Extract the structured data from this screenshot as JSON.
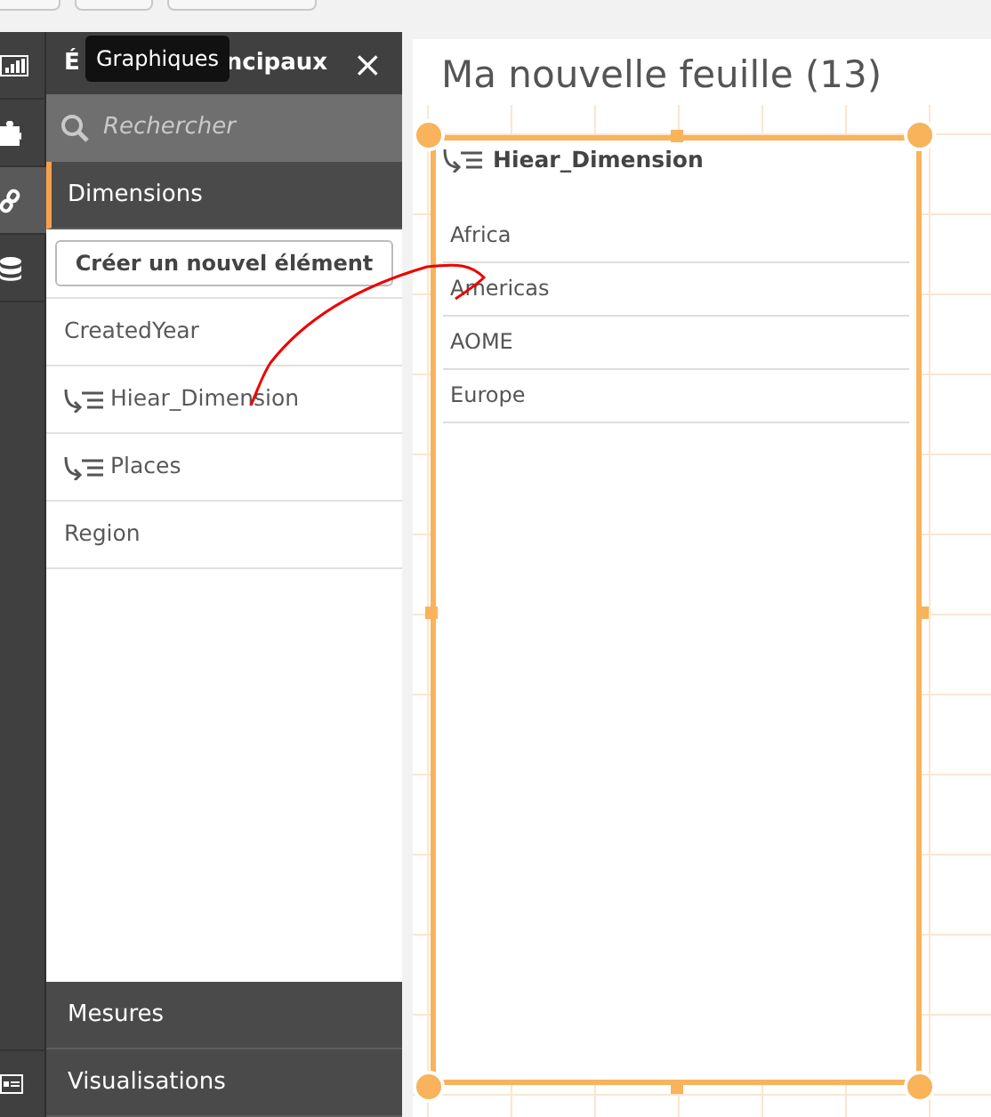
{
  "rail": {
    "items": [
      {
        "kind": "charts",
        "selected": false
      },
      {
        "kind": "extensions",
        "selected": false
      },
      {
        "kind": "fields",
        "selected": true
      },
      {
        "kind": "data",
        "selected": false
      },
      {
        "kind": "visual",
        "selected": false
      }
    ]
  },
  "tooltip": {
    "text": "Graphiques"
  },
  "panel": {
    "title_parts": [
      "É",
      "ncipaux"
    ],
    "close": "×",
    "search": {
      "placeholder": "Rechercher"
    },
    "sections": [
      {
        "label": "Dimensions",
        "expanded": true
      },
      {
        "label": "Mesures",
        "expanded": false
      },
      {
        "label": "Visualisations",
        "expanded": false
      }
    ],
    "create_button": "Créer un nouvel élément",
    "items": [
      {
        "label": "CreatedYear",
        "kind": "field"
      },
      {
        "label": "Hiear_Dimension",
        "kind": "hierarchy"
      },
      {
        "label": "Places",
        "kind": "hierarchy"
      },
      {
        "label": "Region",
        "kind": "field"
      }
    ]
  },
  "sheet": {
    "title": "Ma nouvelle feuille (13)",
    "object": {
      "title": "Hiear_Dimension",
      "kind": "hierarchy",
      "selected": true,
      "values": [
        "Africa",
        "Americas",
        "AOME",
        "Europe"
      ]
    }
  }
}
